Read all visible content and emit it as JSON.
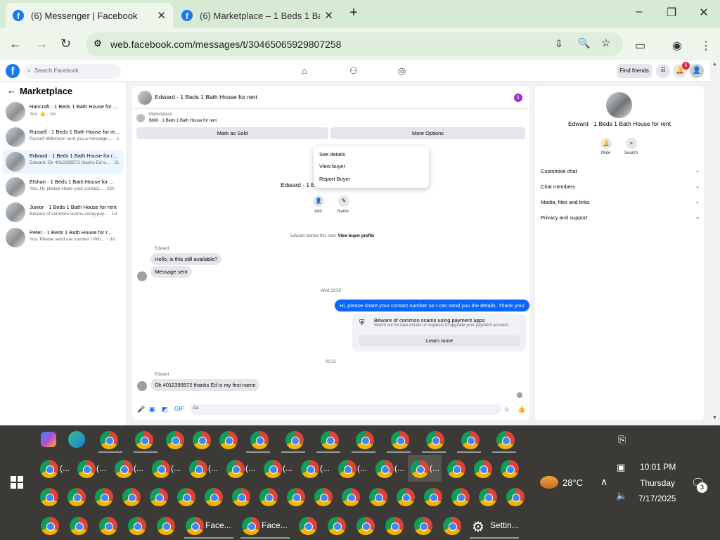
{
  "browser": {
    "tabs": [
      {
        "title": "(6) Messenger | Facebook",
        "active": true
      },
      {
        "title": "(6) Marketplace – 1 Beds 1 Bath",
        "active": false
      }
    ],
    "url": "web.facebook.com/messages/t/30465065929807258"
  },
  "fb_header": {
    "search_placeholder": "Search Facebook",
    "find_friends": "Find friends",
    "notification_count": "6"
  },
  "left_panel": {
    "title": "Marketplace",
    "conversations": [
      {
        "name": "Haircraft · 1 Beds 1 Bath House for ...",
        "preview": "You: 👍 · 1m"
      },
      {
        "name": "Russell · 1 Beds 1 Bath House for re...",
        "preview": "Russell Wilkinson sent you a message ... · 1h"
      },
      {
        "name": "Edward · 1 Beds 1 Bath House for r...",
        "preview": "Edward: Ok 4012399572 thanks Ed is... · 21h"
      },
      {
        "name": "Elshan · 1 Beds 1 Bath House for ...",
        "preview": "You: Hi, please share your contact... · 22h"
      },
      {
        "name": "Junior · 1 Beds 1 Bath House for rent",
        "preview": "Beware of common scams using pay... · 1d"
      },
      {
        "name": "Peter · 1 Beds 1 Bath House for r...",
        "preview": "You: Please send me number I Will ... · 3d"
      }
    ]
  },
  "chat": {
    "title": "Edward · 1 Beds 1 Bath House for rent",
    "marketplace_label": "Marketplace",
    "listing": "$600 · 1 Beds 1 Bath House for rent",
    "mark_sold": "Mark as Sold",
    "more_options": "More Options",
    "dropdown": [
      "See details",
      "View buyer",
      "Report Buyer"
    ],
    "profile_name": "Edward · 1 Be",
    "add_label": "Add",
    "name_label": "Name",
    "started_text": "Edward started this chat.",
    "view_buyer_profile": "View buyer profile",
    "sender_label": "Edward",
    "msg1": "Hello, is this still available?",
    "msg2": "Message sent",
    "time1": "Wed 23:59",
    "my_msg": "Hi, please share your contact number so I can send you the details. Thank you!",
    "scam_title": "Beware of common scams using payment apps",
    "scam_sub": "Watch out for fake emails or requests to upgrade your payment account.",
    "learn_more": "Learn more",
    "time2": "00:21",
    "sender_label2": "Edward",
    "msg3": "Ok 4012399572 thanks Ed is my first name",
    "composer_placeholder": "Aa"
  },
  "right_panel": {
    "name": "Edward · 1 Beds 1 Bath House for rent",
    "mute": "Mute",
    "search": "Search",
    "sections": [
      "Customise chat",
      "Chat members",
      "Media, files and links",
      "Privacy and support"
    ]
  },
  "taskbar": {
    "weather": "28°C",
    "time": "10:01 PM",
    "day": "Thursday",
    "date": "7/17/2025",
    "notif_count": "3",
    "row2_label": "(...",
    "face_label": "Face...",
    "settings_label": "Settin..."
  }
}
